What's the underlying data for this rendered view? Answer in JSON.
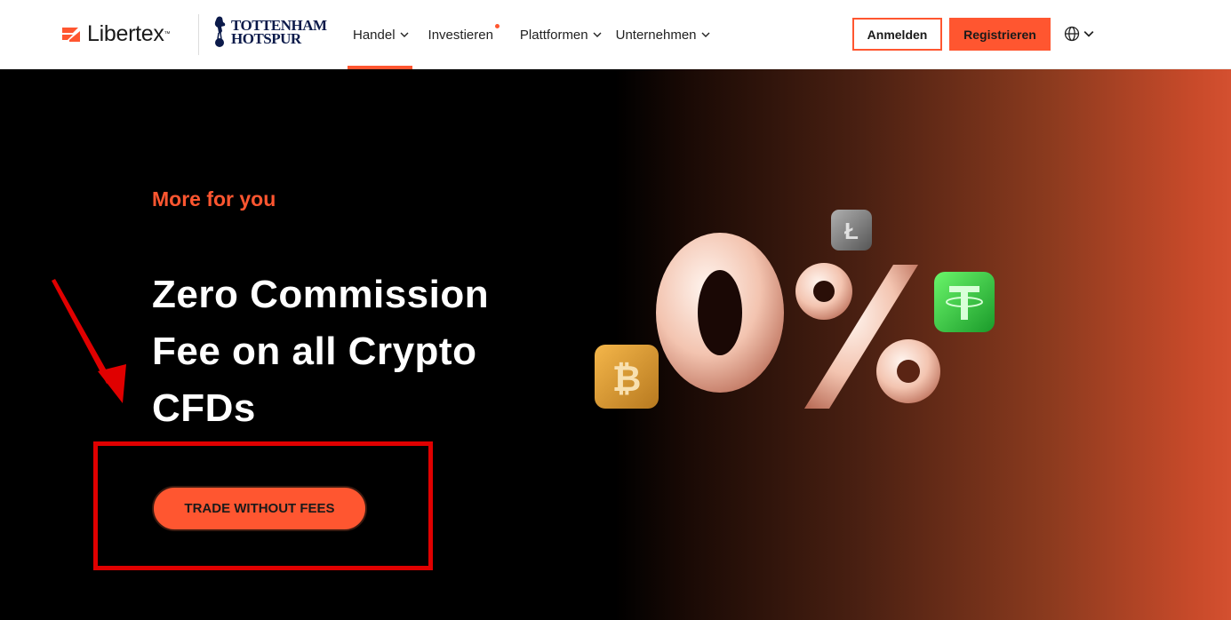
{
  "header": {
    "logo_text": "Libertex",
    "logo_tm": "™",
    "partner_line1": "TOTTENHAM",
    "partner_line2": "HOTSPUR",
    "nav": [
      {
        "label": "Handel",
        "has_chevron": true,
        "active": true
      },
      {
        "label": "Investieren",
        "has_chevron": false,
        "dot": true
      },
      {
        "label": "Plattformen",
        "has_chevron": true
      },
      {
        "label": "Unternehmen",
        "has_chevron": true
      }
    ],
    "login_label": "Anmelden",
    "register_label": "Registrieren",
    "language_icon": "globe-icon"
  },
  "hero": {
    "eyebrow": "More for you",
    "headline_line1": "Zero Commission",
    "headline_line2": "Fee on all Crypto",
    "headline_line3": "CFDs",
    "cta_label": "TRADE WITHOUT FEES",
    "graphic_text": "0%",
    "coins": [
      "litecoin-icon",
      "tether-icon",
      "bitcoin-icon"
    ]
  },
  "colors": {
    "accent": "#ff5630",
    "annotation": "#e00000"
  }
}
